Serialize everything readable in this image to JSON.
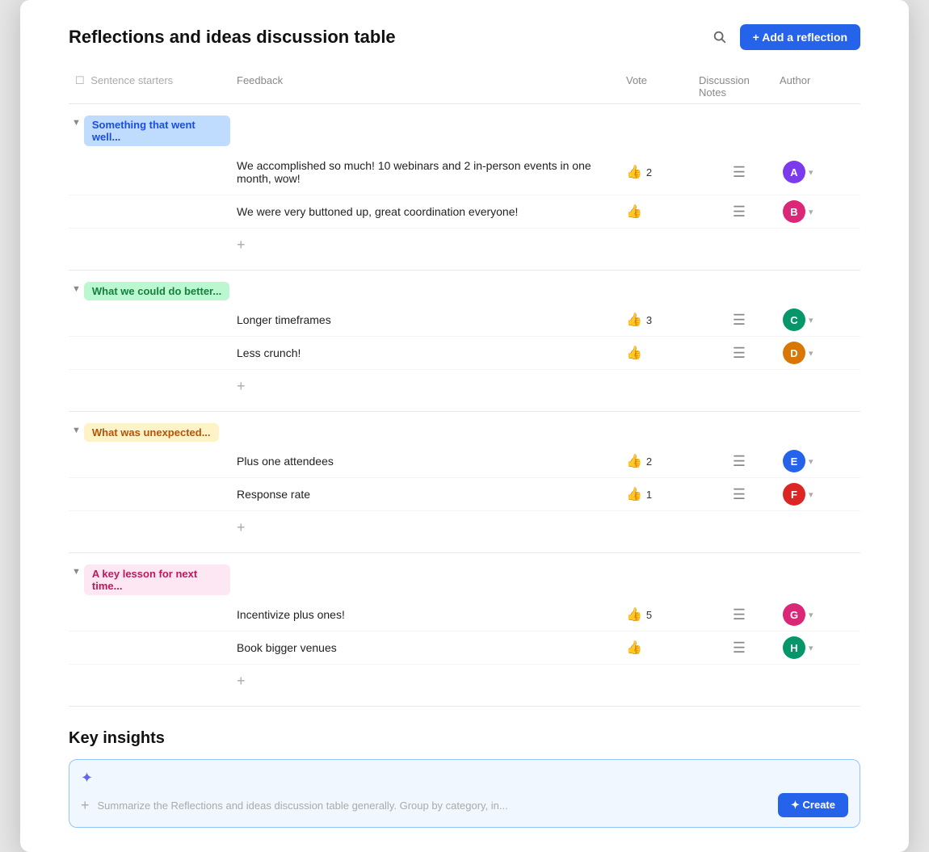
{
  "page": {
    "title": "Reflections and ideas discussion table",
    "addButtonLabel": "+ Add a reflection",
    "columns": {
      "sentenceStarters": "Sentence starters",
      "feedback": "Feedback",
      "vote": "Vote",
      "discussionNotes": "Discussion Notes",
      "author": "Author"
    },
    "sections": [
      {
        "id": "s1",
        "label": "Something that went well...",
        "labelClass": "label-blue",
        "items": [
          {
            "feedback": "We accomplished so much! 10 webinars and 2 in-person events in one month, wow!",
            "voteCount": "2",
            "hasNotes": true,
            "authorInitial": "A",
            "authorClass": "avatar-1"
          },
          {
            "feedback": "We were very buttoned up, great coordination everyone!",
            "voteCount": "",
            "hasNotes": true,
            "authorInitial": "B",
            "authorClass": "avatar-2"
          }
        ]
      },
      {
        "id": "s2",
        "label": "What we could do better...",
        "labelClass": "label-green",
        "items": [
          {
            "feedback": "Longer timeframes",
            "voteCount": "3",
            "hasNotes": true,
            "authorInitial": "C",
            "authorClass": "avatar-3"
          },
          {
            "feedback": "Less crunch!",
            "voteCount": "",
            "hasNotes": true,
            "authorInitial": "D",
            "authorClass": "avatar-4"
          }
        ]
      },
      {
        "id": "s3",
        "label": "What was unexpected...",
        "labelClass": "label-yellow",
        "items": [
          {
            "feedback": "Plus one attendees",
            "voteCount": "2",
            "hasNotes": true,
            "authorInitial": "E",
            "authorClass": "avatar-5"
          },
          {
            "feedback": "Response rate",
            "voteCount": "1",
            "hasNotes": true,
            "authorInitial": "F",
            "authorClass": "avatar-6"
          }
        ]
      },
      {
        "id": "s4",
        "label": "A key lesson for next time...",
        "labelClass": "label-pink",
        "items": [
          {
            "feedback": "Incentivize plus ones!",
            "voteCount": "5",
            "hasNotes": true,
            "authorInitial": "G",
            "authorClass": "avatar-2"
          },
          {
            "feedback": "Book bigger venues",
            "voteCount": "",
            "hasNotes": true,
            "authorInitial": "H",
            "authorClass": "avatar-3"
          }
        ]
      }
    ],
    "insights": {
      "title": "Key insights",
      "placeholder": "Summarize the Reflections and ideas discussion table generally. Group by category, in...",
      "createLabel": "✦ Create"
    }
  }
}
